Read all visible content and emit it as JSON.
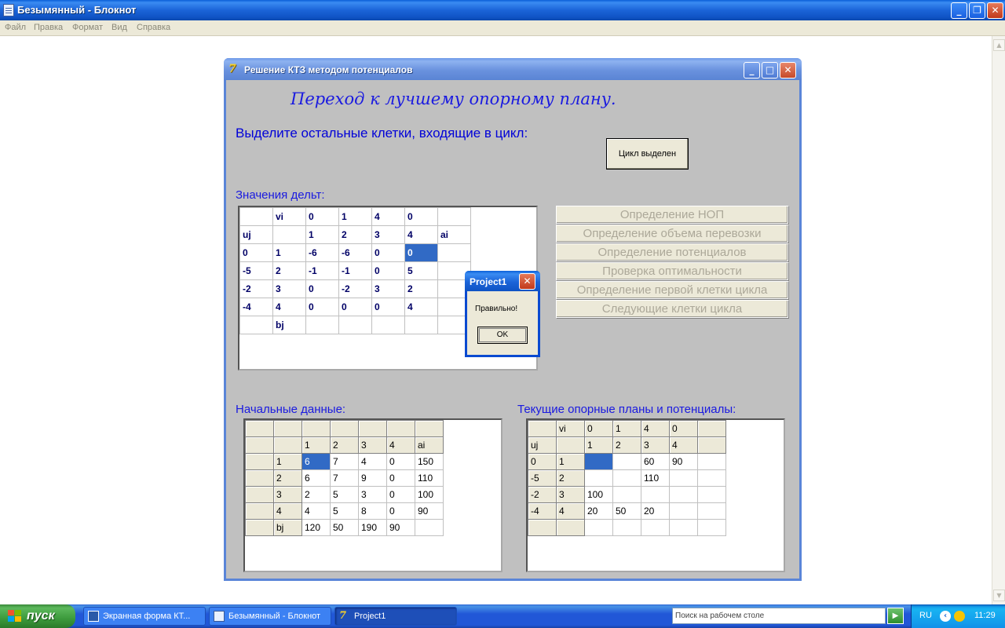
{
  "notepad": {
    "title": "Безымянный - Блокнот",
    "menu": [
      "Файл",
      "Правка",
      "Формат",
      "Вид",
      "Справка"
    ]
  },
  "project_window": {
    "title": "Решение КТЗ методом потенциалов",
    "heading": "Переход к лучшему опорному плану.",
    "instruction": "Выделите остальные клетки, входящие в цикл:",
    "cycle_button": "Цикл выделен",
    "deltas_label": "Значения дельт:",
    "deltas_table": [
      [
        "",
        "vi",
        "0",
        "1",
        "4",
        "0",
        ""
      ],
      [
        "uj",
        "",
        "1",
        "2",
        "3",
        "4",
        "ai"
      ],
      [
        "0",
        "1",
        "-6",
        "-6",
        "0",
        "0",
        ""
      ],
      [
        "-5",
        "2",
        "-1",
        "-1",
        "0",
        "5",
        ""
      ],
      [
        "-2",
        "3",
        "0",
        "-2",
        "3",
        "2",
        ""
      ],
      [
        "-4",
        "4",
        "0",
        "0",
        "0",
        "4",
        ""
      ],
      [
        "",
        "bj",
        "",
        "",
        "",
        "",
        ""
      ]
    ],
    "side_buttons": [
      "Определение НОП",
      "Определение объема перевозки",
      "Определение потенциалов",
      "Проверка оптимальности",
      "Определение первой клетки цикла",
      "Следующие клетки цикла"
    ],
    "initial_label": "Начальные данные:",
    "initial_table": [
      [
        "",
        "",
        "",
        "",
        "",
        "",
        ""
      ],
      [
        "",
        "",
        "1",
        "2",
        "3",
        "4",
        "ai"
      ],
      [
        "",
        "1",
        "6",
        "7",
        "4",
        "0",
        "150"
      ],
      [
        "",
        "2",
        "6",
        "7",
        "9",
        "0",
        "110"
      ],
      [
        "",
        "3",
        "2",
        "5",
        "3",
        "0",
        "100"
      ],
      [
        "",
        "4",
        "4",
        "5",
        "8",
        "0",
        "90"
      ],
      [
        "",
        "bj",
        "120",
        "50",
        "190",
        "90",
        ""
      ]
    ],
    "current_label": "Текущие опорные планы и потенциалы:",
    "current_table": [
      [
        "",
        "vi",
        "0",
        "1",
        "4",
        "0",
        ""
      ],
      [
        "uj",
        "",
        "1",
        "2",
        "3",
        "4",
        ""
      ],
      [
        "0",
        "1",
        "",
        "",
        "60",
        "90",
        ""
      ],
      [
        "-5",
        "2",
        "",
        "",
        "110",
        "",
        ""
      ],
      [
        "-2",
        "3",
        "100",
        "",
        "",
        "",
        ""
      ],
      [
        "-4",
        "4",
        "20",
        "50",
        "20",
        "",
        ""
      ],
      [
        "",
        "",
        "",
        "",
        "",
        "",
        ""
      ]
    ]
  },
  "dialog": {
    "title": "Project1",
    "message": "Правильно!",
    "ok": "OK"
  },
  "taskbar": {
    "start": "пуск",
    "tasks": [
      "Экранная форма КТ...",
      "Безымянный - Блокнот",
      "Project1"
    ],
    "search_placeholder": "Поиск на рабочем столе",
    "lang": "RU",
    "clock": "11:29"
  },
  "colors": {
    "selection": "#316ac5",
    "label_blue": "#1a1ae0",
    "window_bg": "#c0c0c0"
  }
}
